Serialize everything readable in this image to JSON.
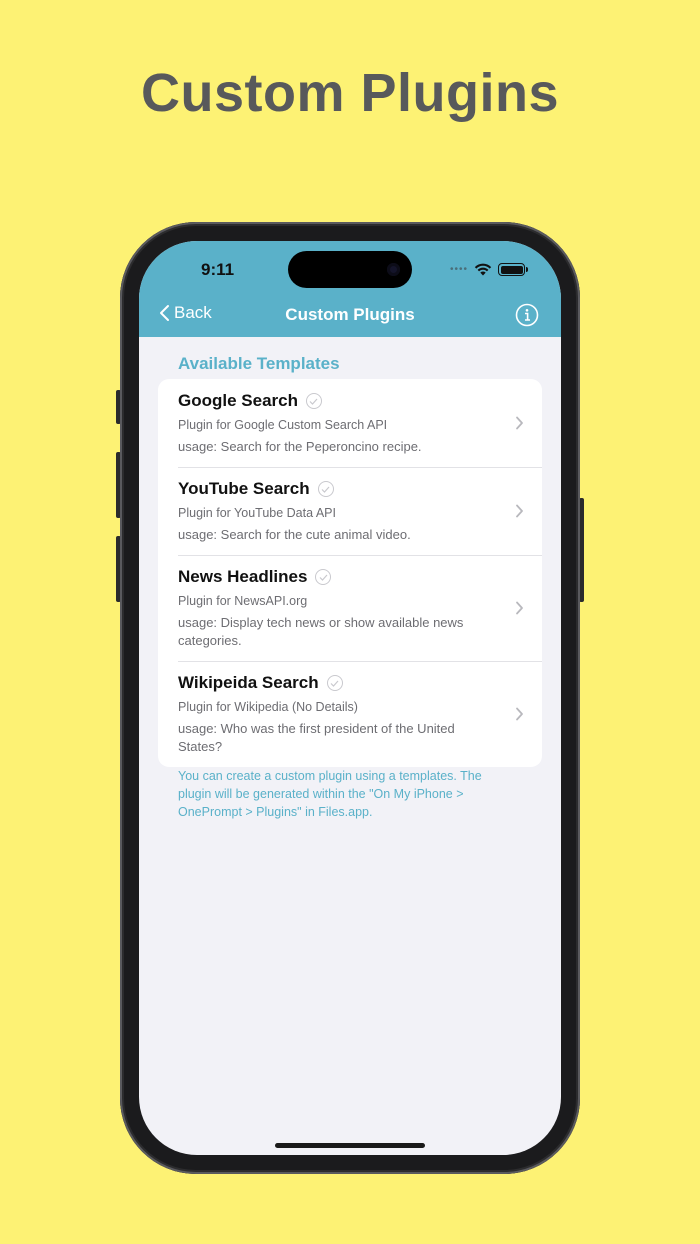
{
  "headline": "Custom Plugins",
  "colors": {
    "background": "#FDF274",
    "accent": "#5AB1C9",
    "nav_text": "#FFFFFF"
  },
  "status_bar": {
    "time": "9:11",
    "icons": [
      "cellular-dots-icon",
      "wifi-icon",
      "battery-icon"
    ]
  },
  "nav": {
    "back_label": "Back",
    "title": "Custom Plugins",
    "info_icon": "info-icon"
  },
  "section": {
    "header": "Available Templates"
  },
  "templates": [
    {
      "title": "Google Search",
      "subtitle": "Plugin for Google Custom Search API",
      "usage": "usage: Search for the Peperoncino recipe."
    },
    {
      "title": "YouTube Search",
      "subtitle": "Plugin for YouTube Data API",
      "usage": "usage: Search for the cute animal video."
    },
    {
      "title": "News Headlines",
      "subtitle": "Plugin for NewsAPI.org",
      "usage": "usage: Display tech news or show available news categories."
    },
    {
      "title": "Wikipeida Search",
      "subtitle": "Plugin for Wikipedia (No Details)",
      "usage": "usage: Who was the first president of the United States?"
    }
  ],
  "footer": "You can create a custom plugin using a templates. The plugin will be generated within the \"On My iPhone > OnePrompt > Plugins\" in Files.app."
}
